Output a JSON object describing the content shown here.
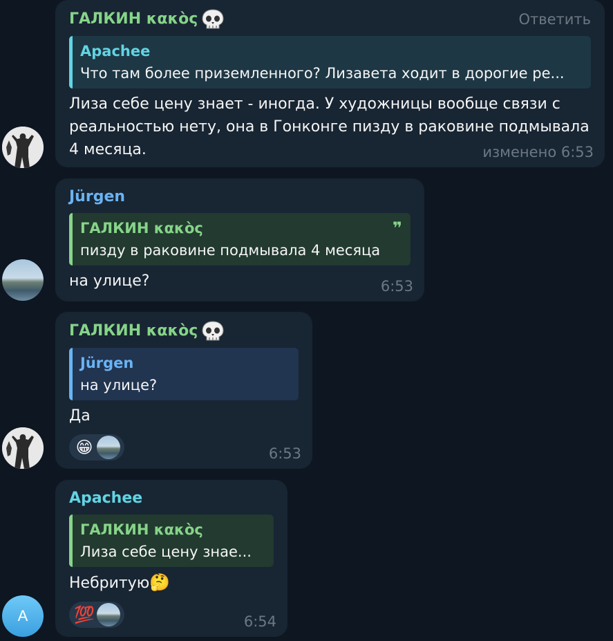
{
  "messages": [
    {
      "sender": "ГАЛКИН κακὸς",
      "reply_action": "Ответить",
      "quote_name": "Apachee",
      "quote_text": "Что там более приземленного? Лизавета ходит в дорогие ре...",
      "text": "Лиза  себе цену знает - иногда. У художницы вообще связи с реальностью нету, она в Гонконге пизду в раковине подмывала 4 месяца.",
      "time": "изменено 6:53"
    },
    {
      "sender": "Jürgen",
      "quote_name": "ГАЛКИН κακὸς",
      "quote_mark": "❞",
      "quote_text": "пизду в раковине подмывала 4 месяца",
      "text": "на улице?",
      "time": "6:53"
    },
    {
      "sender": "ГАЛКИН κακὸς",
      "quote_name": "Jürgen",
      "quote_text": "на улице?",
      "text": "Да",
      "reaction": "😁",
      "time": "6:53"
    },
    {
      "sender": "Apachee",
      "avatar_letter": "A",
      "quote_name": "ГАЛКИН κακὸς",
      "quote_text": "Лиза  себе цену знае...",
      "text": "Небритую",
      "text_emoji": "🤔",
      "reaction": "💯",
      "time": "6:54"
    }
  ]
}
